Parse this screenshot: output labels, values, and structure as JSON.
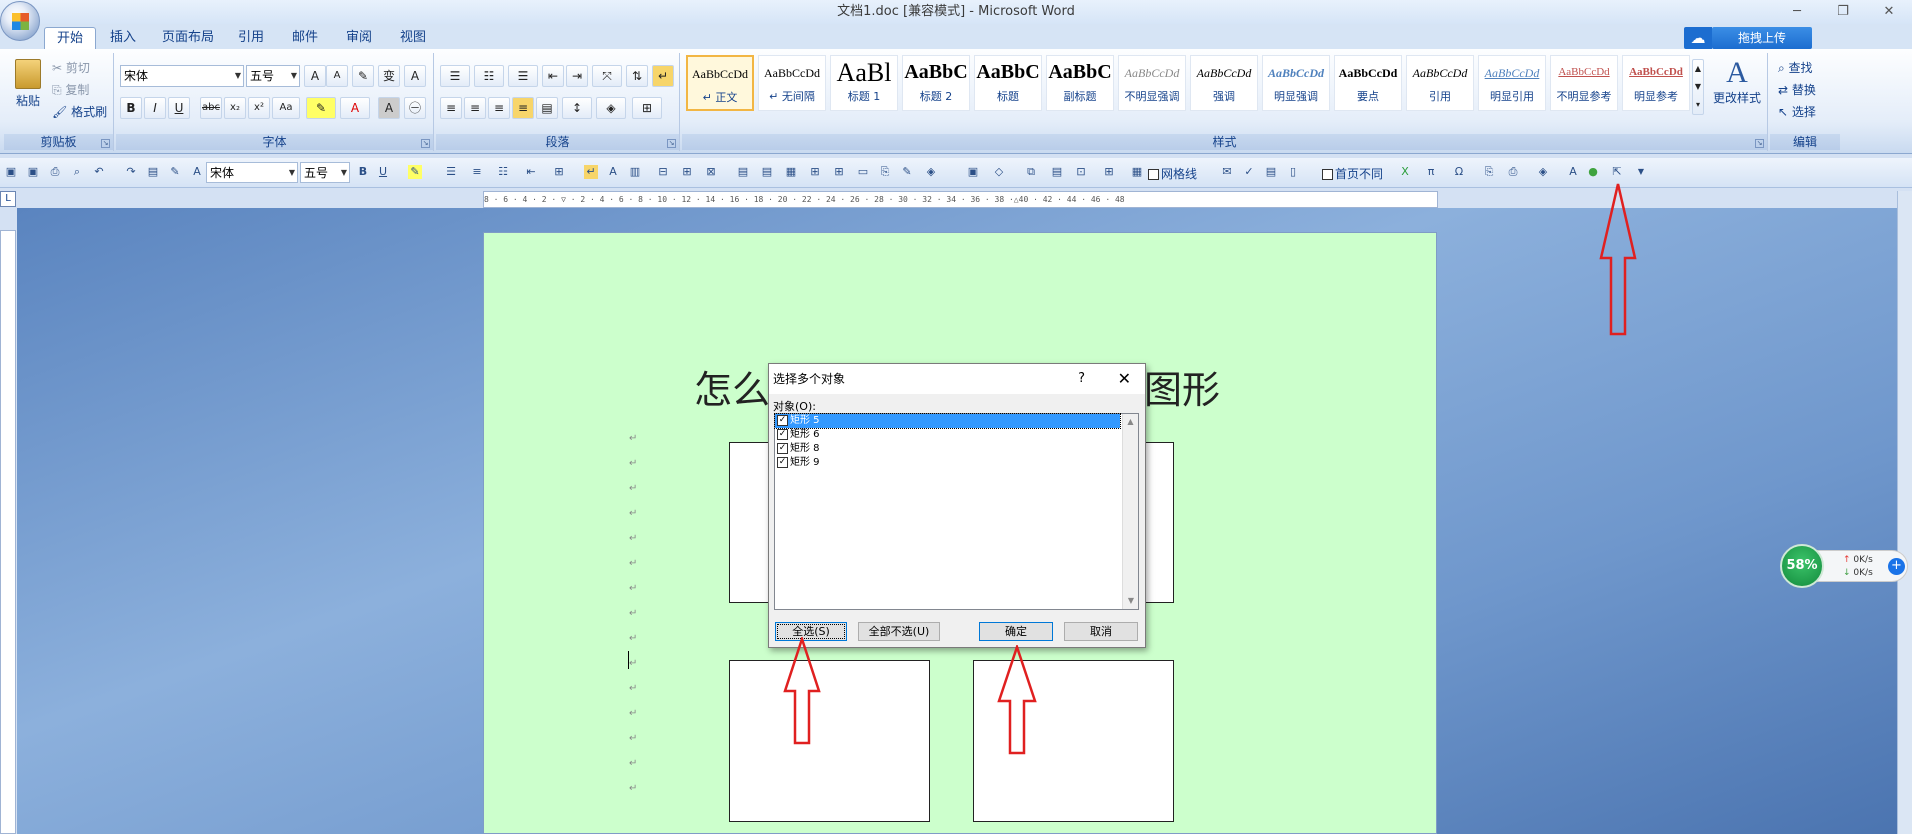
{
  "window": {
    "title": "文档1.doc [兼容模式] - Microsoft Word",
    "minimize": "─",
    "restore": "❐",
    "close": "✕"
  },
  "tabs": [
    "开始",
    "插入",
    "页面布局",
    "引用",
    "邮件",
    "审阅",
    "视图"
  ],
  "cloud_upload": "拖拽上传",
  "clipboard": {
    "paste": "粘贴",
    "cut": "剪切",
    "copy": "复制",
    "format_painter": "格式刷",
    "label": "剪贴板"
  },
  "font": {
    "name": "宋体",
    "size": "五号",
    "label": "字体"
  },
  "paragraph": {
    "label": "段落"
  },
  "styles": {
    "items": [
      {
        "sample": "AaBbCcDd",
        "name": "↵ 正文"
      },
      {
        "sample": "AaBbCcDd",
        "name": "↵ 无间隔"
      },
      {
        "sample": "AaBl",
        "name": "标题 1"
      },
      {
        "sample": "AaBbC",
        "name": "标题 2"
      },
      {
        "sample": "AaBbC",
        "name": "标题"
      },
      {
        "sample": "AaBbC",
        "name": "副标题"
      },
      {
        "sample": "AaBbCcDd",
        "name": "不明显强调"
      },
      {
        "sample": "AaBbCcDd",
        "name": "强调"
      },
      {
        "sample": "AaBbCcDd",
        "name": "明显强调"
      },
      {
        "sample": "AaBbCcDd",
        "name": "要点"
      },
      {
        "sample": "AaBbCcDd",
        "name": "引用"
      },
      {
        "sample": "AaBbCcDd",
        "name": "明显引用"
      },
      {
        "sample": "AaBbCcDd",
        "name": "不明显参考"
      },
      {
        "sample": "AaBbCcDd",
        "name": "明显参考"
      }
    ],
    "change": "更改样式",
    "label": "样式"
  },
  "editing": {
    "find": "查找",
    "replace": "替换",
    "select": "选择",
    "label": "编辑"
  },
  "qat": {
    "font": "宋体",
    "size": "五号",
    "gridlines": "网格线",
    "first_page": "首页不同"
  },
  "ruler": {
    "h": "8 · 6 · 4 · 2 · ▽ · 2 · 4 · 6 · 8 · 10 · 12 · 14 · 16 · 18 · 20 · 22 · 24 · 26 · 28 · 30 · 32 · 34 · 36 · 38 ·△40 · 42 · 44 · 46 · 48"
  },
  "document": {
    "heading_left": "怎么",
    "heading_right": "图形",
    "para_mark": "↵"
  },
  "dialog": {
    "title": "选择多个对象",
    "help": "?",
    "close": "✕",
    "label": "对象(O):",
    "objects": [
      "矩形 5",
      "矩形 6",
      "矩形 8",
      "矩形 9"
    ],
    "select_all": "全选(S)",
    "deselect_all": "全部不选(U)",
    "ok": "确定",
    "cancel": "取消"
  },
  "speed_widget": {
    "percent": "58%",
    "up": "0K/s",
    "down": "0K/s"
  }
}
